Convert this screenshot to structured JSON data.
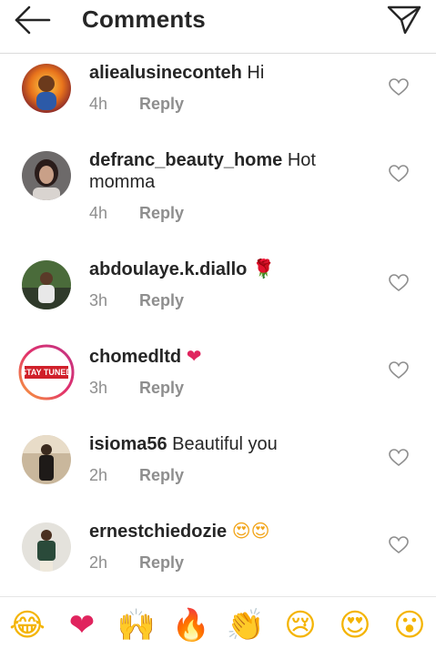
{
  "header": {
    "title": "Comments"
  },
  "comments": [
    {
      "username": "aliealusineconteh",
      "text": "Hi",
      "time": "4h",
      "reply": "Reply"
    },
    {
      "username": "defranc_beauty_home",
      "text": "Hot momma",
      "time": "4h",
      "reply": "Reply"
    },
    {
      "username": "abdoulaye.k.diallo",
      "text": "🌹",
      "time": "3h",
      "reply": "Reply"
    },
    {
      "username": "chomedltd",
      "text": "❤",
      "time": "3h",
      "reply": "Reply",
      "avatar_text": "STAY TUNED"
    },
    {
      "username": "isioma56",
      "text": "Beautiful you",
      "time": "2h",
      "reply": "Reply"
    },
    {
      "username": "ernestchiedozie",
      "text": "😍😍",
      "time": "2h",
      "reply": "Reply"
    }
  ],
  "emoji_bar": [
    "😂",
    "❤",
    "🙌",
    "🔥",
    "👏",
    "😢",
    "😍",
    "😮"
  ],
  "colors": {
    "text": "#262626",
    "secondary": "#8e8e8e",
    "heart_pink": "#e0245e",
    "divider": "#dbdbdb"
  }
}
